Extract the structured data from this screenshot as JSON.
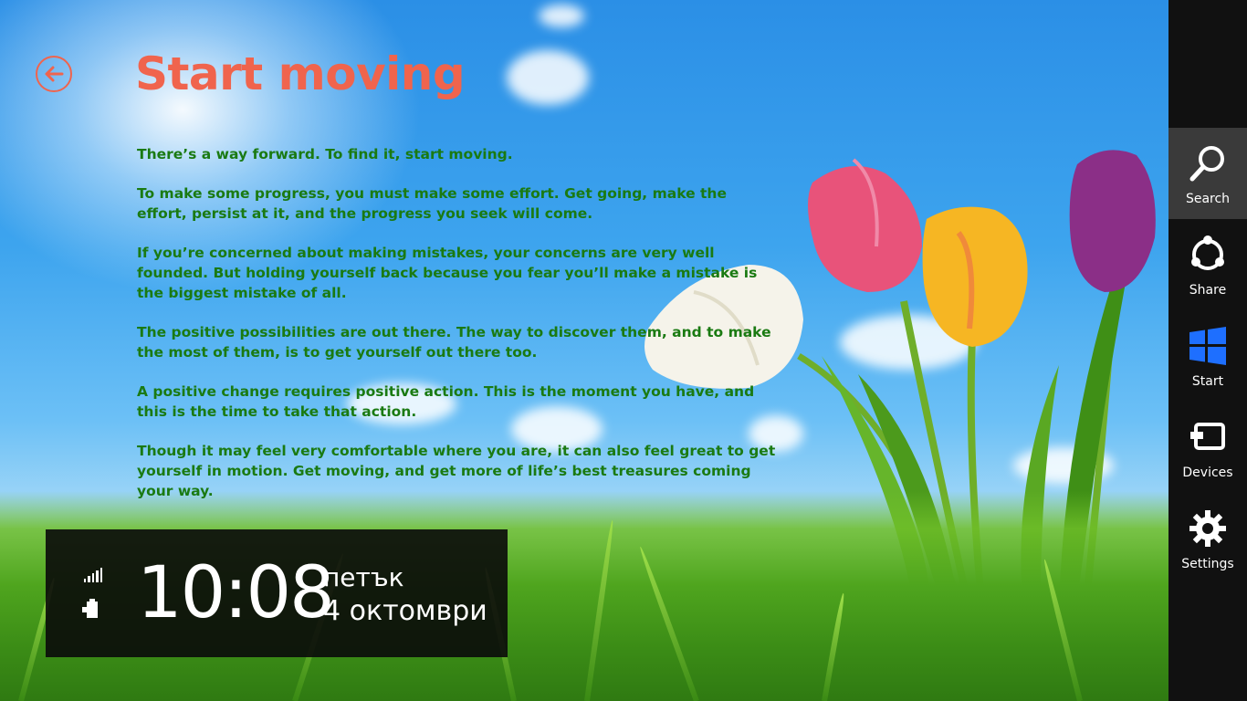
{
  "page": {
    "title": "Start moving",
    "paragraphs": [
      "There’s a way forward. To find it, start moving.",
      "To make some progress, you must make some effort. Get going, make the effort, persist at it, and the progress you seek will come.",
      "If you’re concerned about making mistakes, your concerns are very well founded. But holding yourself back because you fear you’ll make a mistake is the biggest mistake of all.",
      "The positive possibilities are out there. The way to discover them, and to make the most of them, is to get yourself out there too.",
      "A positive change requires positive action. This is the moment you have, and this is the time to take that action.",
      "Though it may feel very comfortable where you are, it can also feel great to get yourself in motion. Get moving, and get more of life’s best treasures coming your way."
    ]
  },
  "clock": {
    "time": "10:08",
    "day": "петък",
    "date": "4 октомври"
  },
  "charms": {
    "items": [
      {
        "label": "Search",
        "icon": "search-icon"
      },
      {
        "label": "Share",
        "icon": "share-icon"
      },
      {
        "label": "Start",
        "icon": "windows-logo-icon"
      },
      {
        "label": "Devices",
        "icon": "devices-icon"
      },
      {
        "label": "Settings",
        "icon": "gear-icon"
      }
    ],
    "active": "Search"
  },
  "colors": {
    "title": "#f0644d",
    "body_text": "#1a7a12",
    "charms_bg": "#111111",
    "windows_logo": "#1e6fff"
  }
}
